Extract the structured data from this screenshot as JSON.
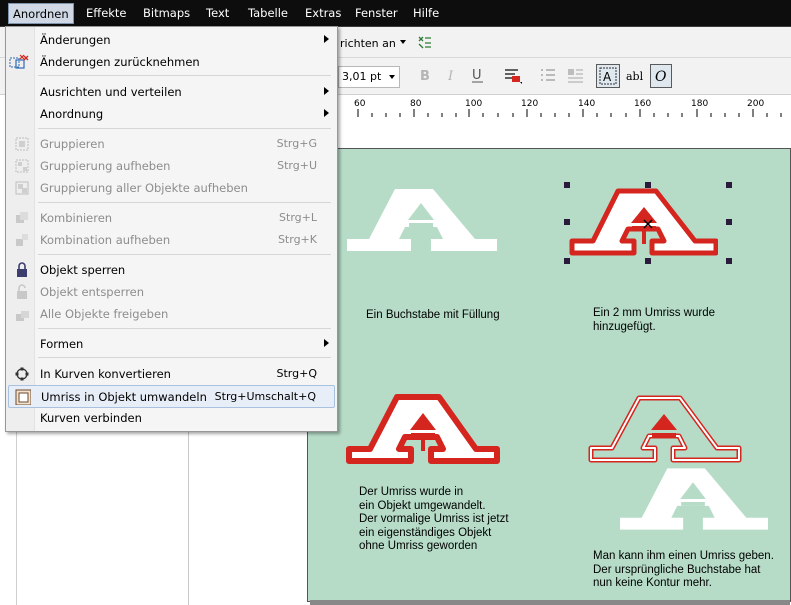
{
  "menubar": {
    "items": [
      "Anordnen",
      "Effekte",
      "Bitmaps",
      "Text",
      "Tabelle",
      "Extras",
      "Fenster",
      "Hilfe"
    ],
    "active": "Anordnen"
  },
  "toolbar": {
    "align_label": "richten an",
    "outline_width": "3,01 pt",
    "text_glyph": "abl"
  },
  "ruler": {
    "ticks": [
      "60",
      "80",
      "100",
      "120",
      "140",
      "160",
      "180",
      "200"
    ]
  },
  "menu": {
    "items": [
      {
        "label": "Änderungen",
        "shortcut": "",
        "submenu": true,
        "disabled": false,
        "icon": ""
      },
      {
        "label": "Änderungen zurücknehmen",
        "shortcut": "",
        "submenu": false,
        "disabled": false,
        "icon": "undo-remove-icon"
      },
      {
        "label": "Ausrichten und verteilen",
        "shortcut": "",
        "submenu": true,
        "disabled": false,
        "icon": ""
      },
      {
        "label": "Anordnung",
        "shortcut": "",
        "submenu": true,
        "disabled": false,
        "icon": ""
      },
      {
        "label": "Gruppieren",
        "shortcut": "Strg+G",
        "submenu": false,
        "disabled": true,
        "icon": "group-icon"
      },
      {
        "label": "Gruppierung aufheben",
        "shortcut": "Strg+U",
        "submenu": false,
        "disabled": true,
        "icon": "ungroup-icon"
      },
      {
        "label": "Gruppierung aller Objekte aufheben",
        "shortcut": "",
        "submenu": false,
        "disabled": true,
        "icon": "ungroup-all-icon"
      },
      {
        "label": "Kombinieren",
        "shortcut": "Strg+L",
        "submenu": false,
        "disabled": true,
        "icon": "combine-icon"
      },
      {
        "label": "Kombination aufheben",
        "shortcut": "Strg+K",
        "submenu": false,
        "disabled": true,
        "icon": "break-apart-icon"
      },
      {
        "label": "Objekt sperren",
        "shortcut": "",
        "submenu": false,
        "disabled": false,
        "icon": "lock-icon"
      },
      {
        "label": "Objekt entsperren",
        "shortcut": "",
        "submenu": false,
        "disabled": true,
        "icon": "unlock-icon"
      },
      {
        "label": "Alle Objekte freigeben",
        "shortcut": "",
        "submenu": false,
        "disabled": true,
        "icon": "unlock-all-icon"
      },
      {
        "label": "Formen",
        "shortcut": "",
        "submenu": true,
        "disabled": false,
        "icon": ""
      },
      {
        "label": "In Kurven konvertieren",
        "shortcut": "Strg+Q",
        "submenu": false,
        "disabled": false,
        "icon": "convert-to-curves-icon"
      },
      {
        "label": "Umriss in Objekt umwandeln",
        "shortcut": "Strg+Umschalt+Q",
        "submenu": false,
        "disabled": false,
        "icon": "outline-to-object-icon",
        "highlighted": true
      },
      {
        "label": "Kurven verbinden",
        "shortcut": "",
        "submenu": false,
        "disabled": false,
        "icon": ""
      }
    ]
  },
  "captions": {
    "c1": "Ein Buchstabe mit Füllung",
    "c2": "Ein 2 mm Umriss wurde\nhinzugefügt.",
    "c3": "Der Umriss wurde in\nein Objekt umgewandelt.\nDer vormalige Umriss ist jetzt\nein eigenständiges Objekt\nohne Umriss geworden",
    "c4": "Man kann ihm einen Umriss geben.\nDer ursprüngliche Buchstabe hat\nnun keine Kontur mehr."
  },
  "colors": {
    "page": "#b6dcc8",
    "outline_red": "#d4261f",
    "menu_highlight": "#e8eef8"
  }
}
